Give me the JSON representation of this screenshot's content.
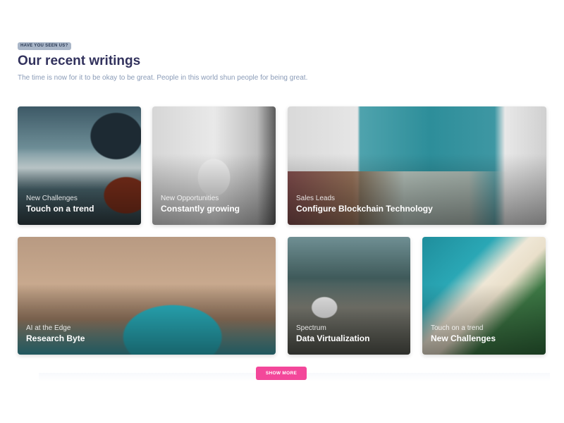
{
  "header": {
    "badge": "HAVE YOU SEEN US?",
    "title": "Our recent writings",
    "subtitle": "The time is now for it to be okay to be great. People in this world shun people for being great."
  },
  "cards": [
    {
      "category": "New Challenges",
      "title": "Touch on a trend"
    },
    {
      "category": "New Opportunities",
      "title": "Constantly growing"
    },
    {
      "category": "Sales Leads",
      "title": "Configure Blockchain Technology"
    },
    {
      "category": "AI at the Edge",
      "title": "Research Byte"
    },
    {
      "category": "Spectrum",
      "title": "Data Virtualization"
    },
    {
      "category": "Touch on a trend",
      "title": "New Challenges"
    }
  ],
  "show_more": {
    "label": "SHOW MORE"
  },
  "colors": {
    "title": "#32325d",
    "subtitle": "#8a9bb7",
    "badge_bg": "#a9b6c8",
    "button_bg": "#f3479a"
  }
}
